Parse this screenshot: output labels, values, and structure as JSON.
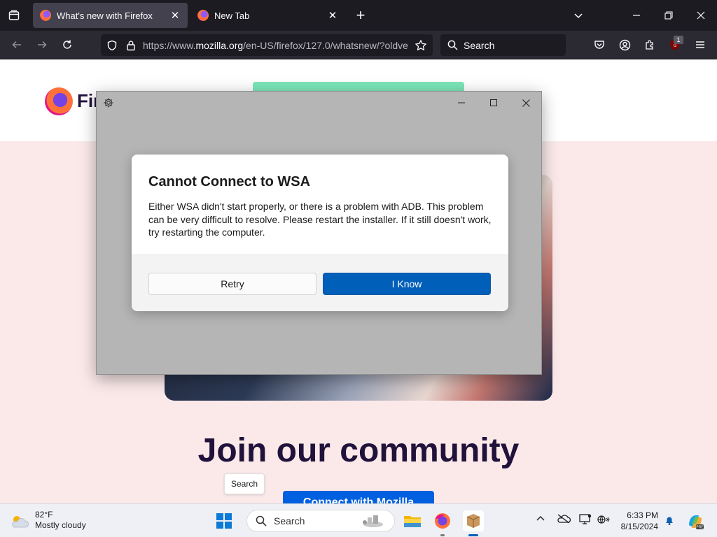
{
  "browser": {
    "tabs": [
      {
        "label": "What's new with Firefox",
        "active": true
      },
      {
        "label": "New Tab",
        "active": false
      }
    ],
    "url_prefix": "https://www.",
    "url_domain": "mozilla.org",
    "url_path": "/en-US/firefox/127.0/whatsnew/?oldve",
    "search_placeholder": "Search",
    "extension_badge": "1",
    "new_tab_symbol": "+"
  },
  "webpage": {
    "logo_text": "Fir",
    "heading": "Join our community",
    "cta_label": "Connect with Mozilla",
    "tooltip": "Search"
  },
  "installer": {
    "dialog_title": "Cannot Connect to WSA",
    "dialog_message": "Either WSA didn't start properly, or there is a problem with ADB. This problem can be very difficult to resolve. Please restart the installer. If it still doesn't work, try restarting the computer.",
    "retry_label": "Retry",
    "confirm_label": "I Know"
  },
  "taskbar": {
    "temperature": "82°F",
    "weather": "Mostly cloudy",
    "search_label": "Search",
    "time": "6:33 PM",
    "date": "8/15/2024"
  },
  "colors": {
    "accent": "#005fb8",
    "firefox_chrome": "#2b2a33",
    "hero_bg": "#fbe9ea",
    "cta": "#0060df"
  }
}
